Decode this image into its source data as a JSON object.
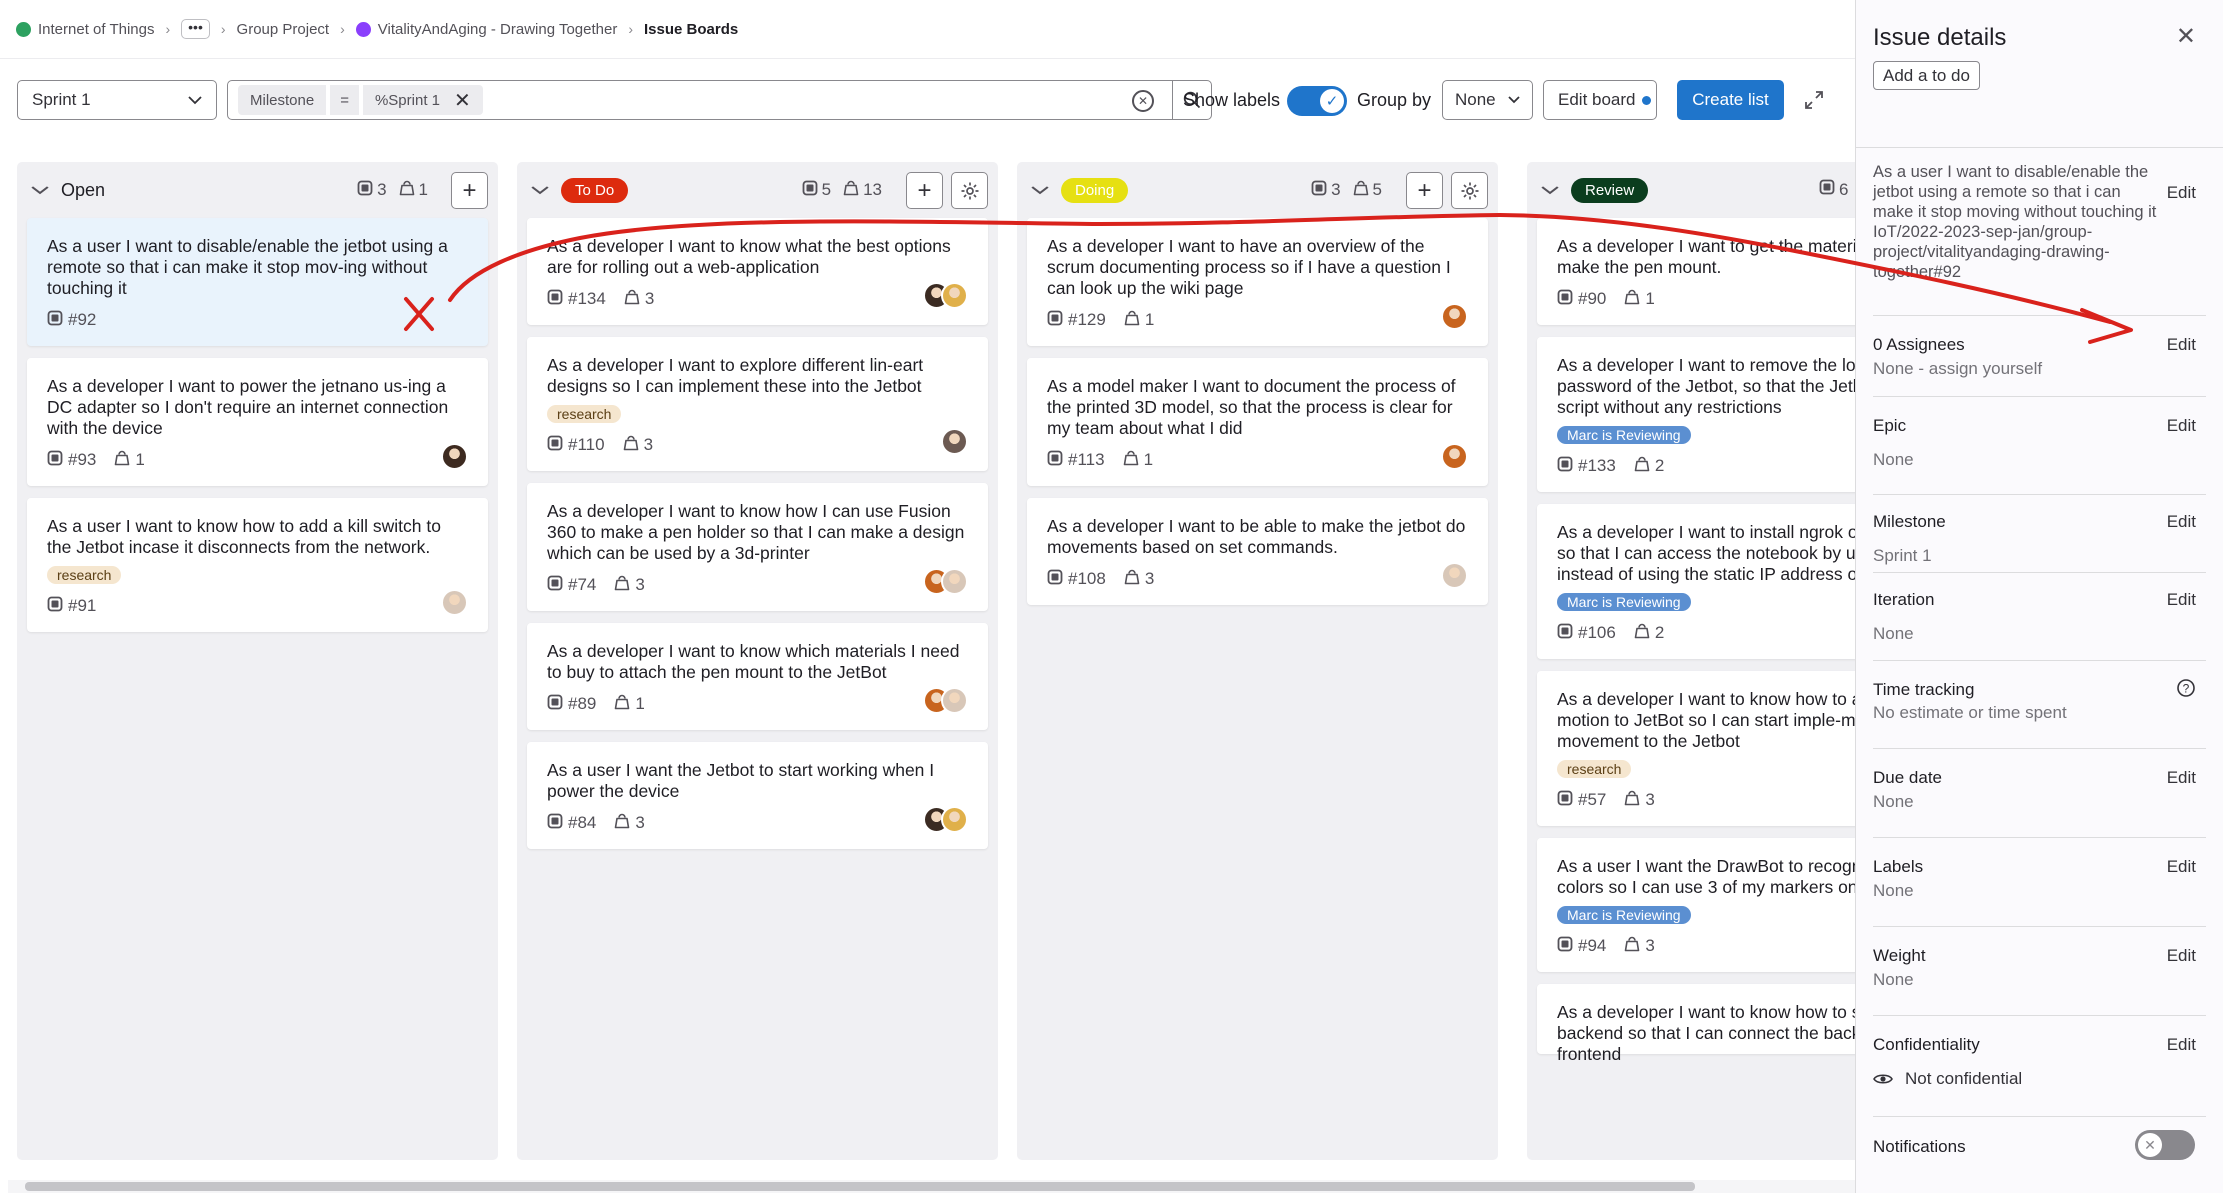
{
  "breadcrumb": {
    "items": [
      "Internet of Things",
      "Group Project",
      "VitalityAndAging - Drawing Together",
      "Issue Boards"
    ],
    "more_label": "•••"
  },
  "toolbar": {
    "sprint_select": "Sprint 1",
    "filter": {
      "field": "Milestone",
      "operator": "=",
      "value": "%Sprint 1"
    },
    "show_labels": "Show labels",
    "group_by": "Group by",
    "group_value": "None",
    "edit_board": "Edit board",
    "create_list": "Create list"
  },
  "lists": [
    {
      "title": "Open",
      "badge_color": "",
      "badge_text_color": "",
      "issues_count": "3",
      "weight_count": "1",
      "cards": [
        {
          "title": "As a user I want to disable/enable the jetbot using a remote so that i can make it stop mov-ing without touching it",
          "label": "",
          "number": "#92",
          "weight": "",
          "avatars": []
        },
        {
          "title": "As a developer I want to power the jetnano us-ing a DC adapter so I don't require an internet connection with the device",
          "label": "",
          "number": "#93",
          "weight": "1",
          "avatars": [
            "#3d2a20"
          ]
        },
        {
          "title": "As a user I want to know how to add a kill switch to the Jetbot incase it disconnects from the network.",
          "label": "research",
          "number": "#91",
          "weight": "",
          "avatars": [
            "#d8c7b8"
          ]
        }
      ]
    },
    {
      "title": "To Do",
      "badge_color": "#dd2b0e",
      "badge_text_color": "#ffffff",
      "issues_count": "5",
      "weight_count": "13",
      "cards": [
        {
          "title": "As a developer I want to know what the best options are for rolling out a web-application",
          "label": "",
          "number": "#134",
          "weight": "3",
          "avatars": [
            "#3b2b22",
            "#e0b04a"
          ]
        },
        {
          "title": "As a developer I want to explore different lin-eart designs so I can implement these into the Jetbot",
          "label": "research",
          "number": "#110",
          "weight": "3",
          "avatars": [
            "#6c5a52"
          ]
        },
        {
          "title": "As a developer I want to know how I can use Fusion 360 to make a pen holder so that I can make a design which can be used by a 3d-printer",
          "label": "",
          "number": "#74",
          "weight": "3",
          "avatars": [
            "#c8641e",
            "#d8c7b8"
          ]
        },
        {
          "title": "As a developer I want to know which materials I need to buy to attach the pen mount to the JetBot",
          "label": "",
          "number": "#89",
          "weight": "1",
          "avatars": [
            "#c8641e",
            "#d8c7b8"
          ]
        },
        {
          "title": "As a user I want the Jetbot to start working when I power the device",
          "label": "",
          "number": "#84",
          "weight": "3",
          "avatars": [
            "#3b2b22",
            "#e0b04a"
          ]
        }
      ]
    },
    {
      "title": "Doing",
      "badge_color": "#e6e012",
      "badge_text_color": "#ffffff",
      "issues_count": "3",
      "weight_count": "5",
      "cards": [
        {
          "title": "As a developer I want to have an overview of the scrum documenting process so if I have a question I can look up the wiki page",
          "label": "",
          "number": "#129",
          "weight": "1",
          "avatars": [
            "#c8641e"
          ]
        },
        {
          "title": "As a model maker I want to document the process of the printed 3D model, so that the process is clear for my team about what I did",
          "label": "",
          "number": "#113",
          "weight": "1",
          "avatars": [
            "#c8641e"
          ]
        },
        {
          "title": "As a developer I want to be able to make the jetbot do movements based on set commands.",
          "label": "",
          "number": "#108",
          "weight": "3",
          "avatars": [
            "#d8c7b8"
          ]
        }
      ]
    },
    {
      "title": "Review",
      "badge_color": "#0b3d1e",
      "badge_text_color": "#ffffff",
      "issues_count": "6",
      "weight_count": "",
      "cards": [
        {
          "title": "As a developer I want to get the materials I need to make the pen mount.",
          "label": "",
          "number": "#90",
          "weight": "1",
          "avatars": []
        },
        {
          "title": "As a developer I want to remove the login and password of the Jetbot, so that the Jetbot can run any script without any restrictions",
          "label": "Marc is Reviewing",
          "number": "#133",
          "weight": "2",
          "avatars": []
        },
        {
          "title": "As a developer I want to install ngrok on the Jetbot, so that I can access the notebook by using the tunnel instead of using the static IP address of the network",
          "label": "Marc is Reviewing",
          "number": "#106",
          "weight": "2",
          "avatars": []
        },
        {
          "title": "As a developer I want to know how to add basic motion to JetBot so I can start imple-menting movement to the Jetbot",
          "label": "research",
          "number": "#57",
          "weight": "3",
          "avatars": []
        },
        {
          "title": "As a user I want the DrawBot to recognize the RGB colors so I can use 3 of my markers on the paper",
          "label": "Marc is Reviewing",
          "number": "#94",
          "weight": "3",
          "avatars": []
        },
        {
          "title": "As a developer I want to know how to set out a backend so that I can connect the backend to the frontend",
          "label": "",
          "number": "",
          "weight": "",
          "avatars": []
        }
      ]
    }
  ],
  "label_colors": {
    "research": {
      "bg": "#f5e6cf",
      "fg": "#5c4016"
    },
    "Marc is Reviewing": {
      "bg": "#5b8fd1",
      "fg": "#ffffff"
    }
  },
  "drawer": {
    "title": "Issue details",
    "add_todo": "Add a to do",
    "issue_title": "As a user I want to disable/enable the jetbot using a remote so that i can make it stop moving without touching it",
    "issue_ref": "IoT/2022-2023-sep-jan/group-project/vitalityandaging-drawing-together#92",
    "edit": "Edit",
    "assignees": {
      "title": "0 Assignees",
      "value": "None - assign yourself"
    },
    "epic": {
      "title": "Epic",
      "value": "None"
    },
    "milestone": {
      "title": "Milestone",
      "value": "Sprint 1"
    },
    "iteration": {
      "title": "Iteration",
      "value": "None"
    },
    "time_tracking": {
      "title": "Time tracking",
      "value": "No estimate or time spent"
    },
    "due_date": {
      "title": "Due date",
      "value": "None"
    },
    "labels": {
      "title": "Labels",
      "value": "None"
    },
    "weight": {
      "title": "Weight",
      "value": "None"
    },
    "confidentiality": {
      "title": "Confidentiality",
      "value": "Not confidential"
    },
    "notifications": {
      "title": "Notifications"
    }
  },
  "colors": {
    "accent": "#1f75cb",
    "annotation_red": "#d9221c",
    "text": "#333238",
    "muted": "#737278"
  }
}
